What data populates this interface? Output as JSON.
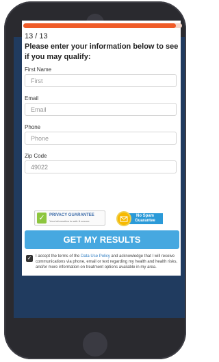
{
  "form": {
    "progress_fraction": 0.96,
    "step_label": "13 / 13",
    "heading": "Please enter your information below to see if you may qualify:",
    "fields": [
      {
        "label": "First Name",
        "placeholder": "First"
      },
      {
        "label": "Email",
        "placeholder": "Email"
      },
      {
        "label": "Phone",
        "placeholder": "Phone"
      },
      {
        "label": "Zip Code",
        "value": "49022"
      }
    ],
    "badges": {
      "privacy_title": "PRIVACY GUARANTEE",
      "privacy_sub": "Your information is safe & secure",
      "spam_line1": "No Spam",
      "spam_line2": "Guarantee"
    },
    "submit_label": "GET MY RESULTS",
    "consent": {
      "prefix": "I accept the terms of the ",
      "link": "Data Use Policy",
      "suffix": " and acknowledge that I will receive communications via phone, email or text regarding my health and health risks, and/or more information on treatment options available in my area."
    }
  },
  "icons": {
    "privacy_check": "check-icon",
    "spam_badge": "envelope-icon",
    "consent_check": "checkbox-checked-icon"
  },
  "colors": {
    "accent_orange": "#ef5b28",
    "button_blue": "#46a8e0",
    "screen_navy": "#203b5f"
  }
}
